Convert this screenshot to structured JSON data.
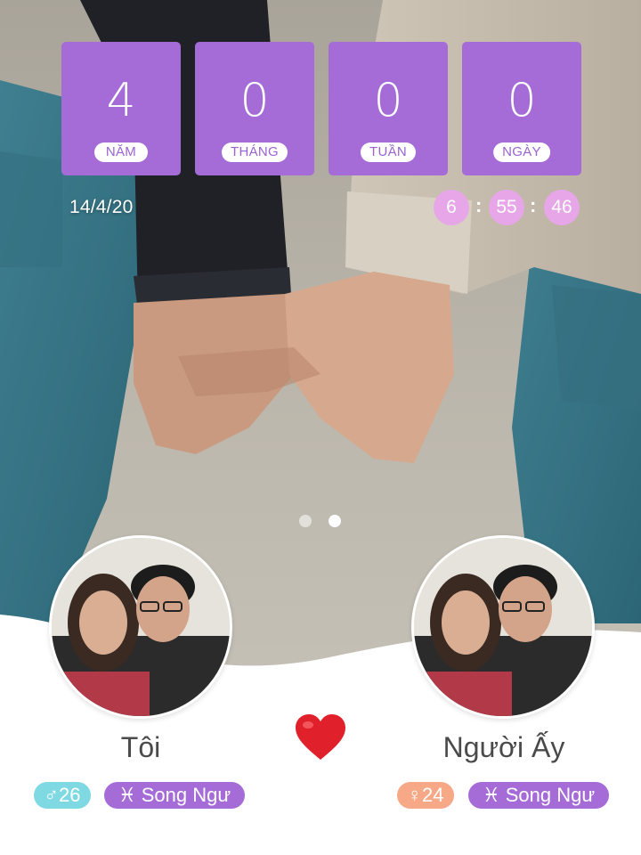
{
  "counter": {
    "years": {
      "value": "4",
      "label": "NĂM"
    },
    "months": {
      "value": "0",
      "label": "THÁNG"
    },
    "weeks": {
      "value": "0",
      "label": "TUẦN"
    },
    "days": {
      "value": "0",
      "label": "NGÀY"
    }
  },
  "start_date": "14/4/20",
  "clock": {
    "hours": "6",
    "minutes": "55",
    "seconds": "46",
    "separator": ":"
  },
  "pager": {
    "total_pages": 2,
    "active_page": 2
  },
  "me": {
    "name": "Tôi",
    "gender_age": "♂26",
    "zodiac": "♓ Song Ngư"
  },
  "partner": {
    "name": "Người Ấy",
    "gender_age": "♀24",
    "zodiac": "♓ Song Ngư"
  },
  "icons": {
    "center": "heart-icon"
  },
  "colors": {
    "tile_purple": "#a56bd6",
    "clock_pink": "#e7a6e8",
    "male_badge": "#7fd9e3",
    "female_badge": "#f7a887",
    "heart_red": "#e0202a"
  }
}
